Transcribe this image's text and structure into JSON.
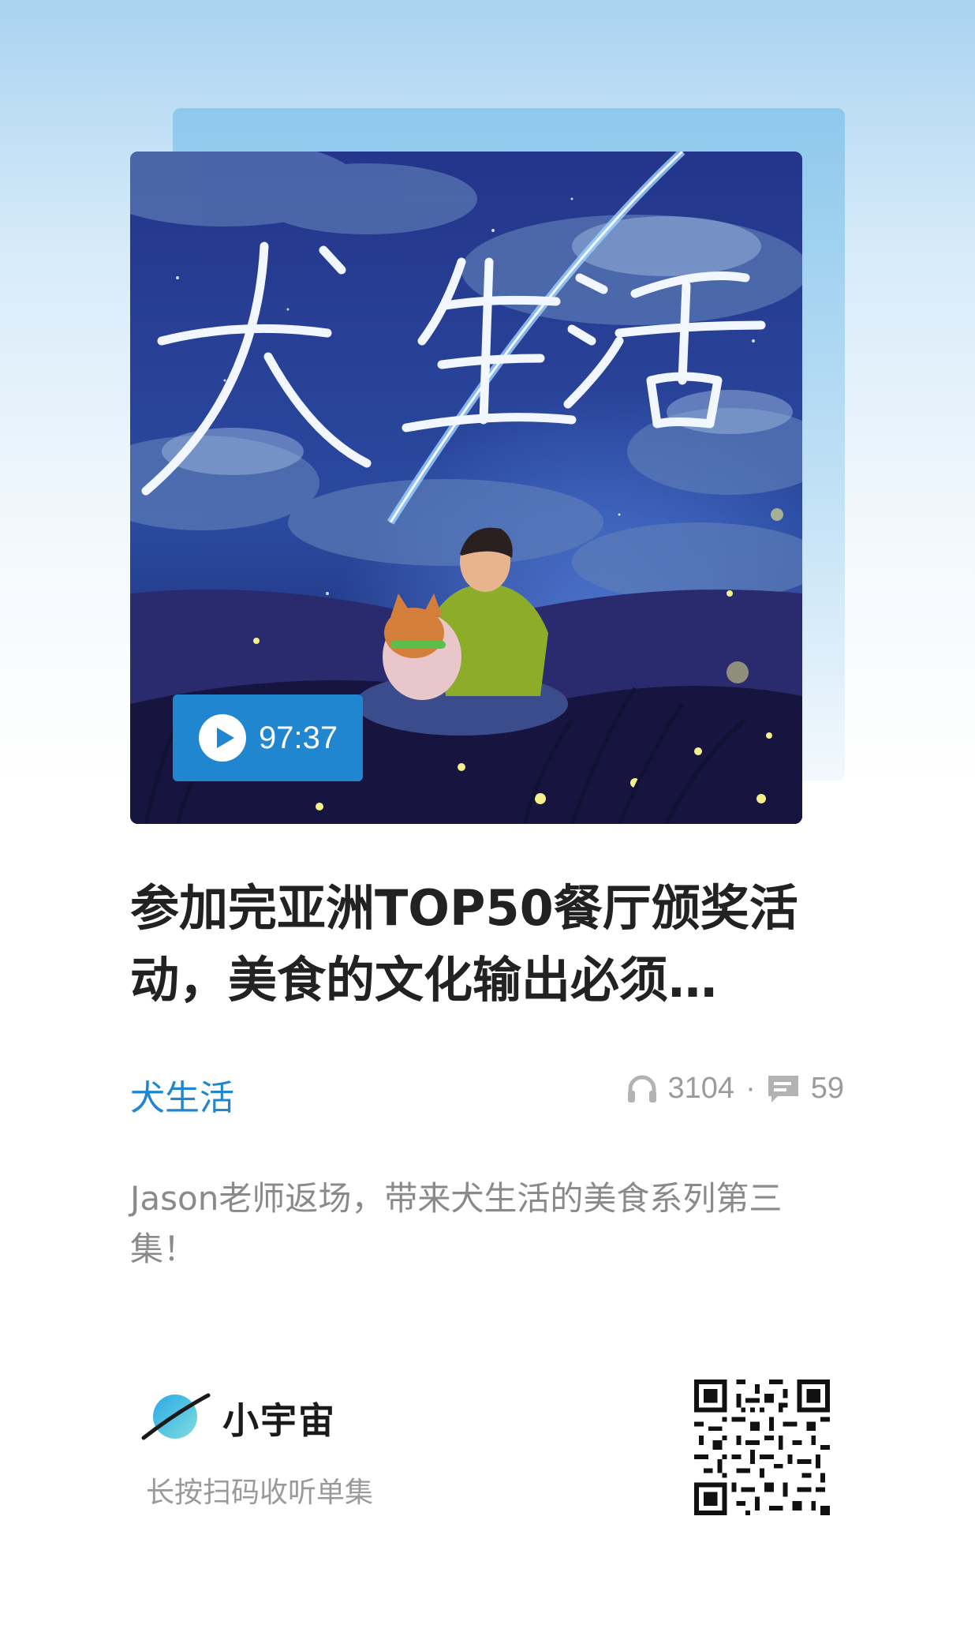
{
  "cover": {
    "title_art": "犬生活",
    "duration": "97:37"
  },
  "episode": {
    "title": "参加完亚洲TOP50餐厅颁奖活动，美食的文化输出必须…",
    "podcast": "犬生活",
    "plays": "3104",
    "separator": "·",
    "comments": "59",
    "description": "Jason老师返场，带来犬生活的美食系列第三集！"
  },
  "footer": {
    "brand": "小宇宙",
    "scan_hint": "长按扫码收听单集"
  },
  "colors": {
    "accent": "#1f86cf",
    "title": "#222222",
    "muted": "#9b9b9b"
  },
  "icons": [
    "play-icon",
    "headphones-icon",
    "comment-icon",
    "planet-logo-icon",
    "qr-code"
  ]
}
